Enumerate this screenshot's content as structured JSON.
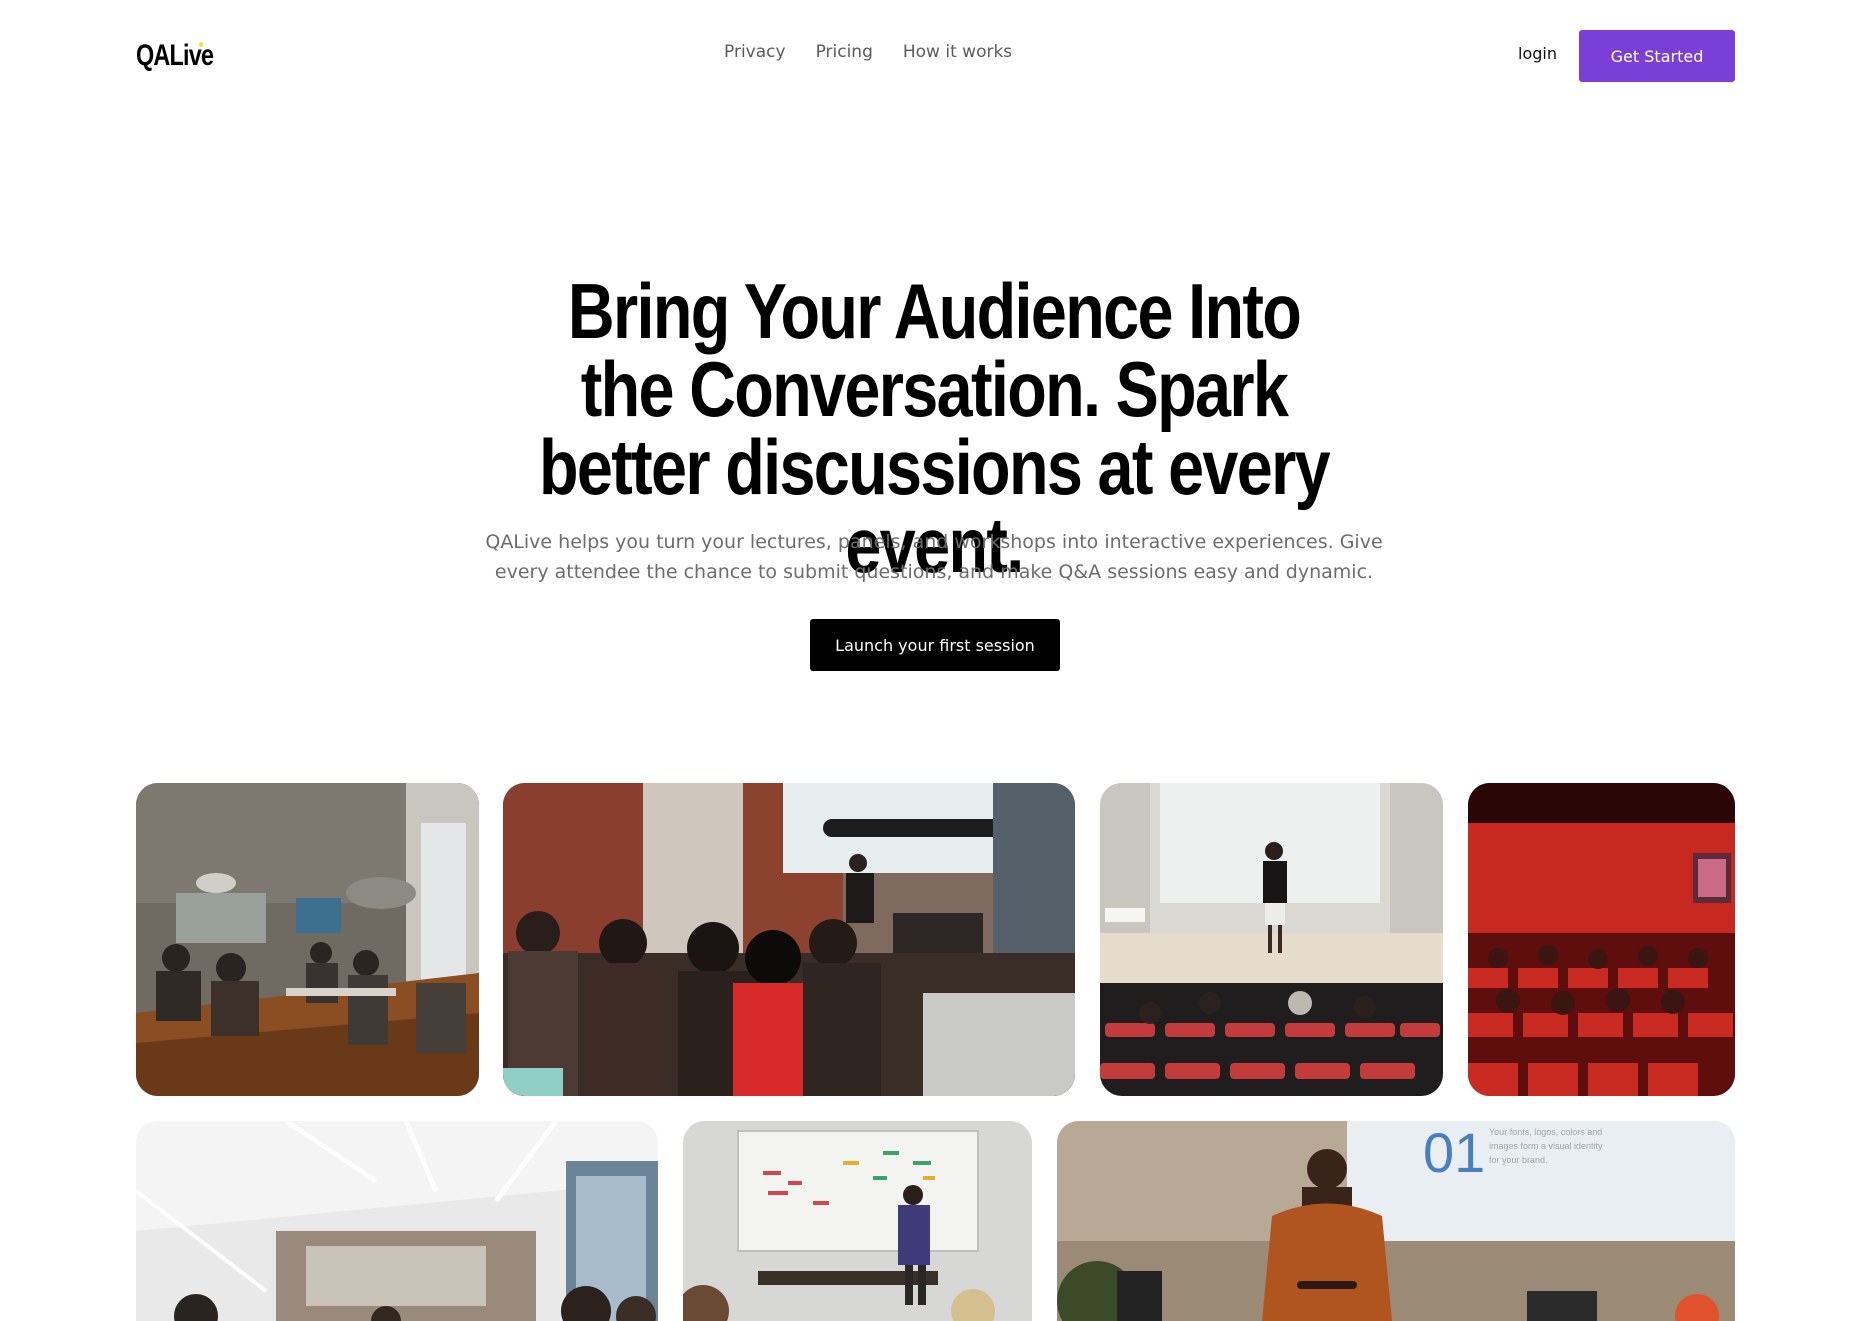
{
  "nav": {
    "logo": "QALive",
    "links": [
      "Privacy",
      "Pricing",
      "How it works"
    ],
    "login": "login",
    "get_started": "Get Started"
  },
  "hero": {
    "title": "Bring Your Audience Into the Conversation. Spark better discussions at every event.",
    "subtitle": "QALive helps you turn your lectures, panels, and workshops into interactive experiences. Give every attendee the chance to submit questions, and make Q&A sessions easy and dynamic.",
    "cta": "Launch your first session"
  },
  "gallery": {
    "slide_number": "01",
    "slide_caption": "Your fonts, logos, colors and images form a visual identity for your brand."
  },
  "colors": {
    "accent": "#7a3fd6",
    "cta": "#000000",
    "text_muted": "#6c6c6c"
  }
}
